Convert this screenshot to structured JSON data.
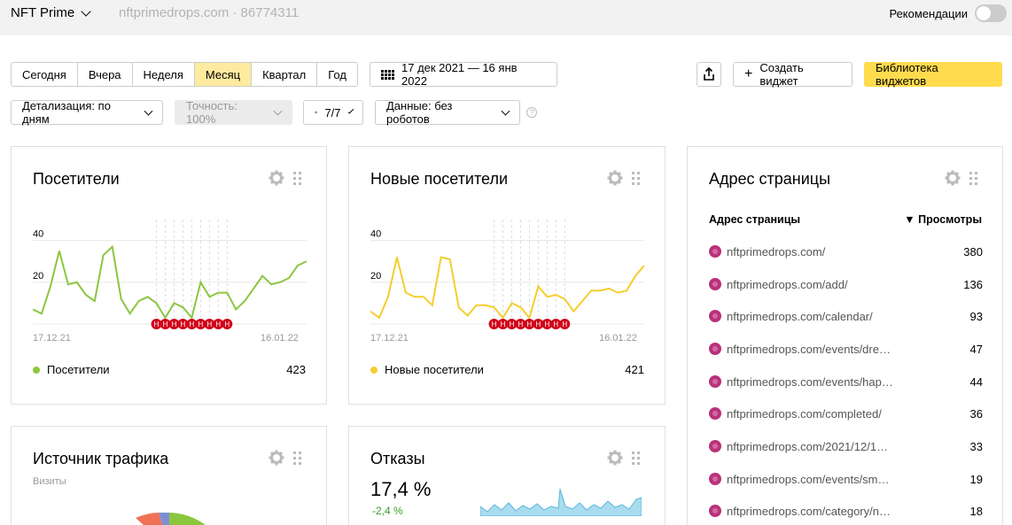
{
  "topbar": {
    "counter_name": "NFT Prime",
    "counter_meta": "nftprimedrops.com · 86774311",
    "recommendations_label": "Рекомендации"
  },
  "toolbar": {
    "periods": [
      "Сегодня",
      "Вчера",
      "Неделя",
      "Месяц",
      "Квартал",
      "Год"
    ],
    "active_period": "Месяц",
    "date_range": "17 дек 2021 — 16 янв 2022",
    "create_widget": "Создать виджет",
    "widget_library": "Библиотека виджетов",
    "detail": "Детализация: по дням",
    "accuracy": "Точность: 100%",
    "segments": "7/7",
    "data_filter": "Данные: без роботов"
  },
  "visitors_card": {
    "title": "Посетители",
    "legend": "Посетители",
    "total": "423",
    "color": "#8cc63f",
    "ytick_top": "40",
    "ytick_mid": "20",
    "x_start": "17.12.21",
    "x_end": "16.01.22",
    "marker": "Н"
  },
  "new_visitors_card": {
    "title": "Новые посетители",
    "legend": "Новые посетители",
    "total": "421",
    "color": "#f5cd2f",
    "ytick_top": "40",
    "ytick_mid": "20",
    "x_start": "17.12.21",
    "x_end": "16.01.22",
    "marker": "Н"
  },
  "pages_card": {
    "title": "Адрес страницы",
    "col_address": "Адрес страницы",
    "col_views": "▼ Просмотры",
    "rows": [
      {
        "url": "nftprimedrops.com/",
        "views": "380"
      },
      {
        "url": "nftprimedrops.com/add/",
        "views": "136"
      },
      {
        "url": "nftprimedrops.com/calendar/",
        "views": "93"
      },
      {
        "url": "nftprimedrops.com/events/dre…",
        "views": "47"
      },
      {
        "url": "nftprimedrops.com/events/hap…",
        "views": "44"
      },
      {
        "url": "nftprimedrops.com/completed/",
        "views": "36"
      },
      {
        "url": "nftprimedrops.com/2021/12/1…",
        "views": "33"
      },
      {
        "url": "nftprimedrops.com/events/sm…",
        "views": "19"
      },
      {
        "url": "nftprimedrops.com/category/n…",
        "views": "18"
      }
    ]
  },
  "traffic_card": {
    "title": "Источник трафика",
    "subtitle": "Визиты"
  },
  "bounce_card": {
    "title": "Отказы",
    "value": "17,4 %",
    "diff": "-2,4 %",
    "color": "#5bb7d9"
  },
  "chart_data": [
    {
      "type": "line",
      "title": "Посетители",
      "ylim": [
        0,
        50
      ],
      "series": [
        {
          "name": "Посетители",
          "values": [
            7,
            5,
            18,
            35,
            19,
            20,
            14,
            11,
            33,
            37,
            12,
            5,
            11,
            13,
            10,
            3,
            10,
            8,
            3,
            20,
            13,
            15,
            15,
            7,
            11,
            17,
            23,
            19,
            20,
            22,
            28,
            30
          ]
        }
      ]
    },
    {
      "type": "line",
      "title": "Новые посетители",
      "ylim": [
        0,
        50
      ],
      "series": [
        {
          "name": "Новые посетители",
          "values": [
            6,
            3,
            13,
            32,
            15,
            13,
            13,
            9,
            32,
            31,
            8,
            4,
            9,
            9,
            8,
            3,
            10,
            8,
            3,
            18,
            13,
            14,
            12,
            6,
            11,
            16,
            16,
            17,
            15,
            16,
            23,
            28
          ]
        }
      ]
    }
  ]
}
